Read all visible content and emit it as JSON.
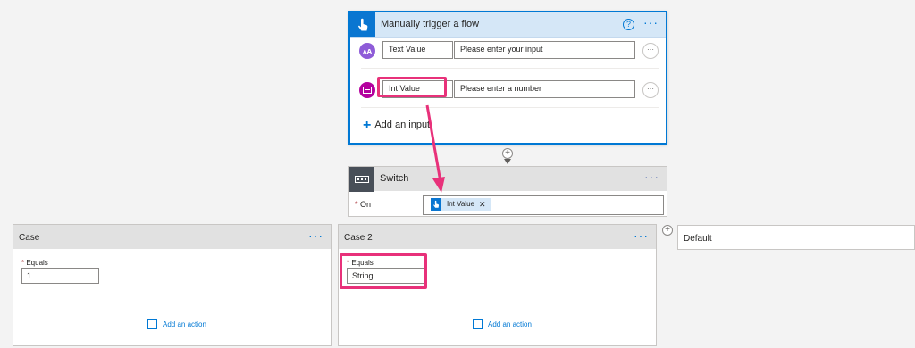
{
  "trigger": {
    "title": "Manually trigger a flow",
    "help_icon": "help-icon",
    "more_label": "···",
    "inputs": [
      {
        "name_value": "Text Value",
        "placeholder": "Please enter your input",
        "icon": "text-type-icon",
        "icon_color": "#8e5cd8",
        "icon_glyph": "AA"
      },
      {
        "name_value": "Int Value",
        "placeholder": "Please enter a number",
        "icon": "number-type-icon",
        "icon_color": "#b4009e",
        "icon_glyph": "12"
      }
    ],
    "add_input_label": "Add an input"
  },
  "switch_action": {
    "title": "Switch",
    "more_label": "···",
    "on_label": "On",
    "token_label": "Int Value"
  },
  "cases": [
    {
      "title": "Case",
      "equals_label": "Equals",
      "equals_value": "1",
      "add_action_label": "Add an action",
      "more_label": "···"
    },
    {
      "title": "Case 2",
      "equals_label": "Equals",
      "equals_value": "String",
      "add_action_label": "Add an action",
      "more_label": "···"
    }
  ],
  "default_branch": {
    "title": "Default"
  },
  "colors": {
    "accent": "#0078d4",
    "annotation": "#e8317a",
    "trigger_header": "#d5e7f7"
  }
}
